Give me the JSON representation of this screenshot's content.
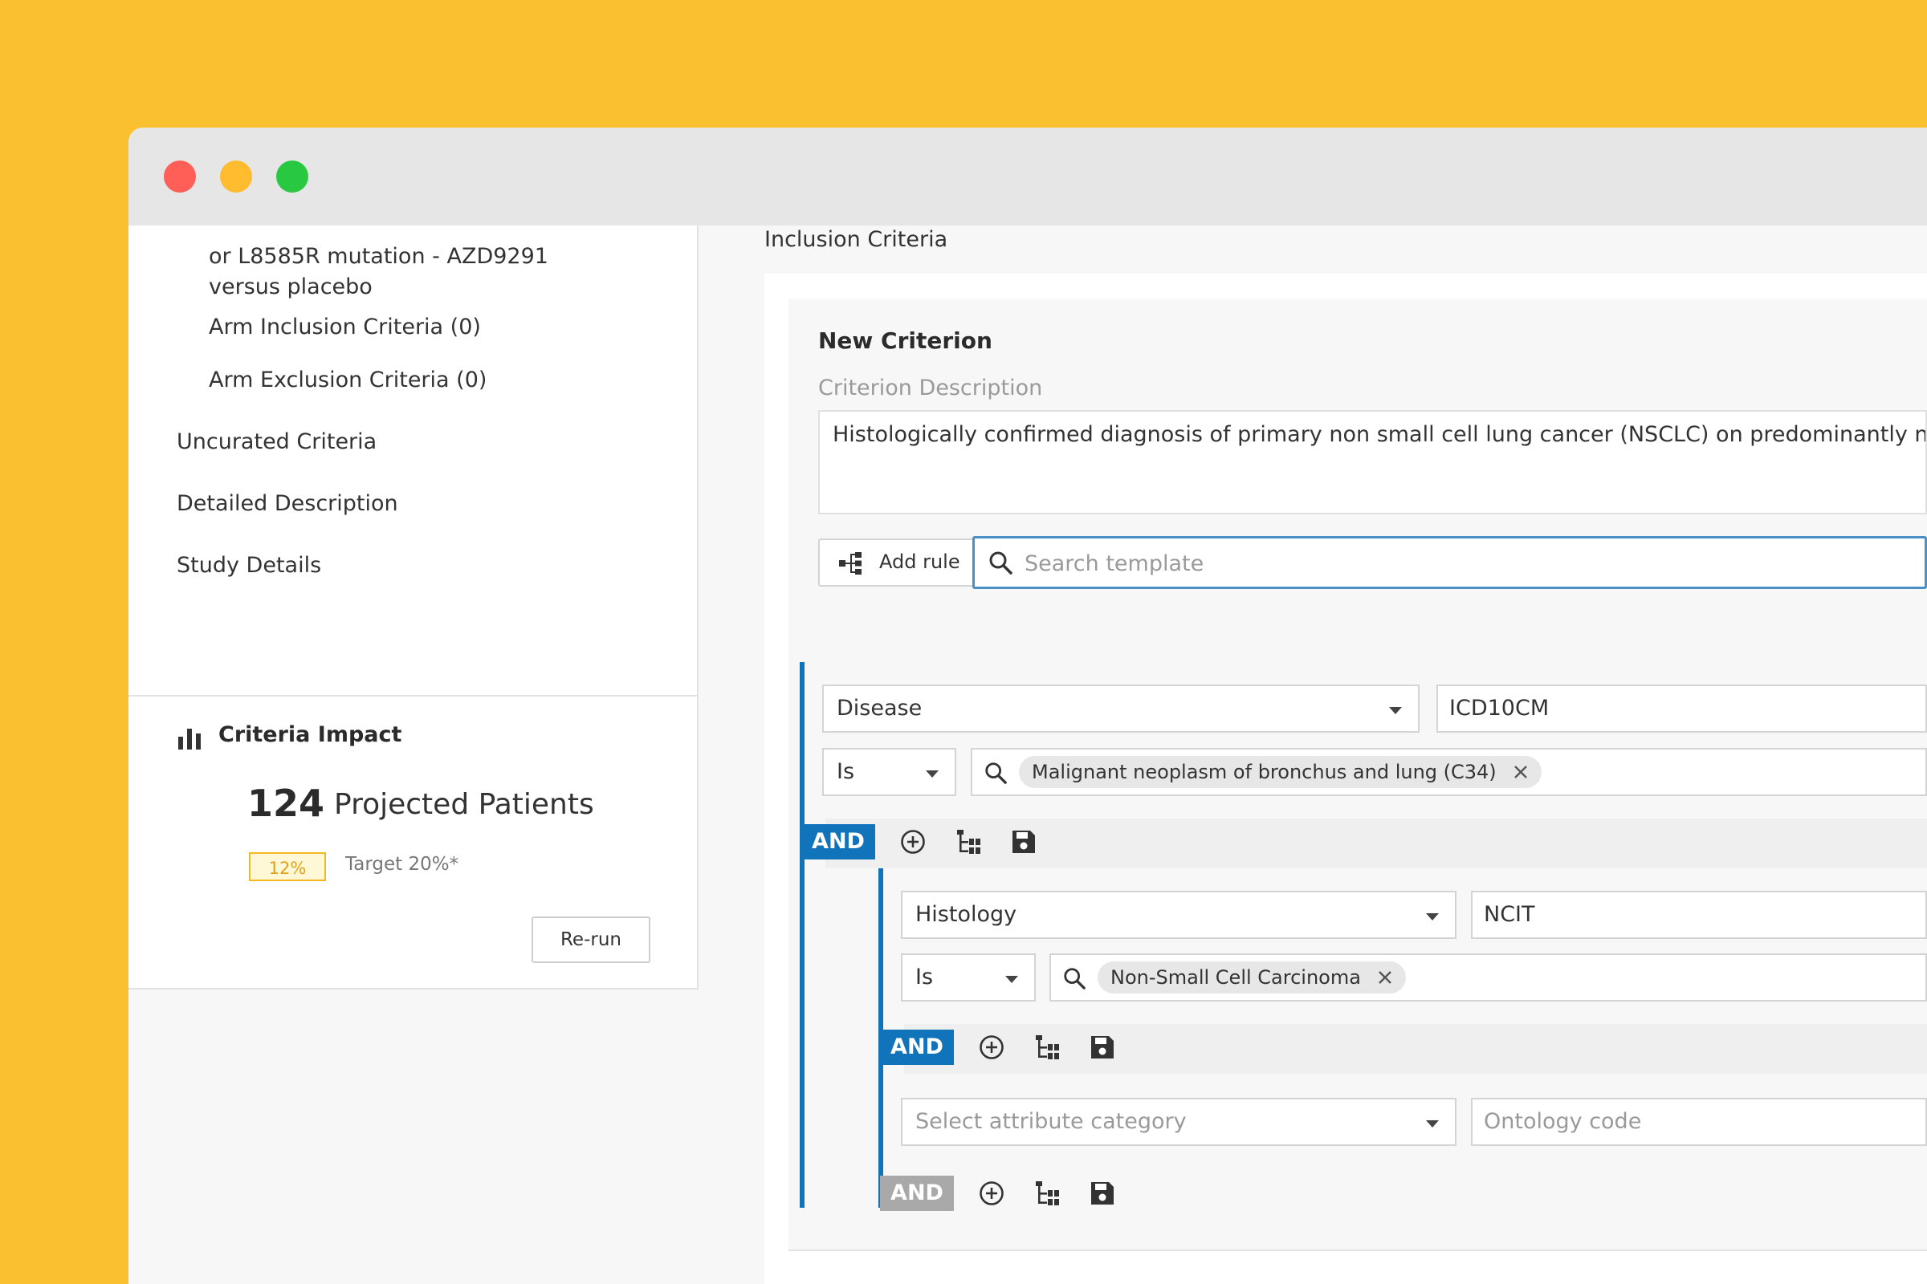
{
  "sidebar": {
    "arm_title_line1": "or L8585R mutation - AZD9291",
    "arm_title_line2": "versus placebo",
    "arm_inclusion": "Arm Inclusion Criteria (0)",
    "arm_exclusion": "Arm Exclusion Criteria (0)",
    "uncurated": "Uncurated Criteria",
    "detailed_description": "Detailed Description",
    "study_details": "Study Details"
  },
  "impact": {
    "title": "Criteria Impact",
    "count": "124",
    "count_label": "Projected Patients",
    "percent": "12%",
    "target": "Target 20%*",
    "rerun_label": "Re-run"
  },
  "main": {
    "section_title": "Inclusion Criteria",
    "new_criterion_title": "New Criterion",
    "description_label": "Criterion Description",
    "description_text": "Histologically confirmed diagnosis of primary non small cell lung cancer (NSCLC) on predominantly non-",
    "add_rule_label": "Add rule",
    "search_placeholder": "Search template"
  },
  "rules": {
    "group1": {
      "category": "Disease",
      "ontology": "ICD10CM",
      "operator": "Is",
      "value_chip": "Malignant neoplasm of bronchus and lung (C34)",
      "connector": "AND"
    },
    "group2": {
      "category": "Histology",
      "ontology": "NCIT",
      "operator": "Is",
      "value_chip": "Non-Small Cell Carcinoma",
      "connector": "AND"
    },
    "group3": {
      "category_placeholder": "Select attribute category",
      "ontology_placeholder": "Ontology code",
      "connector": "AND"
    }
  },
  "colors": {
    "background": "#FBC02F",
    "accent": "#1173BA",
    "badge_border": "#F6B820",
    "inactive": "#a9a9a9"
  },
  "icons": {
    "traffic_lights": [
      "close-dot",
      "minimize-dot",
      "maximize-dot"
    ],
    "impact": "bar-chart-icon",
    "add_rule": "hierarchy-icon",
    "search": "search-icon",
    "operations": [
      "add-circle-icon",
      "subtree-icon",
      "save-icon"
    ],
    "chip_remove": "close-icon"
  }
}
